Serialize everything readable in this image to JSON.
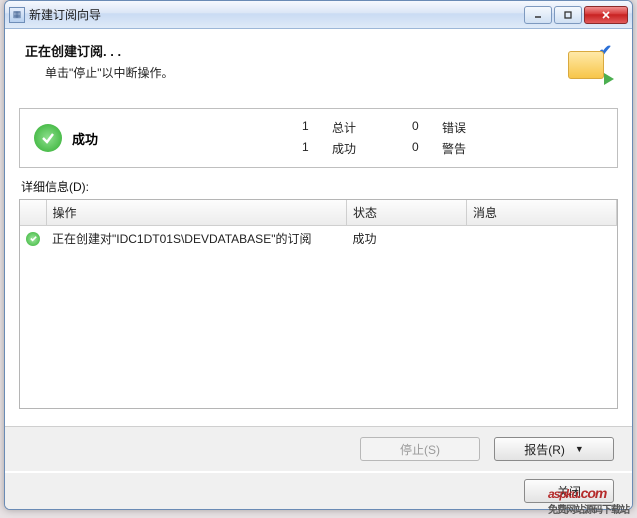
{
  "window": {
    "title": "新建订阅向导"
  },
  "header": {
    "title": "正在创建订阅. . .",
    "subtitle": "单击\"停止\"以中断操作。"
  },
  "status": {
    "label": "成功",
    "total_count": "1",
    "total_label": "总计",
    "success_count": "1",
    "success_label": "成功",
    "error_count": "0",
    "error_label": "错误",
    "warn_count": "0",
    "warn_label": "警告"
  },
  "details": {
    "label": "详细信息(D):",
    "columns": {
      "icon": "",
      "action": "操作",
      "state": "状态",
      "message": "消息"
    },
    "rows": [
      {
        "action": "正在创建对\"IDC1DT01S\\DEVDATABASE\"的订阅",
        "state": "成功",
        "message": ""
      }
    ]
  },
  "buttons": {
    "stop": "停止(S)",
    "report": "报告(R)",
    "close": "关闭"
  },
  "watermark": {
    "brand": "aspku",
    "suffix": ".com",
    "tagline": "免费网站源码下载站"
  }
}
